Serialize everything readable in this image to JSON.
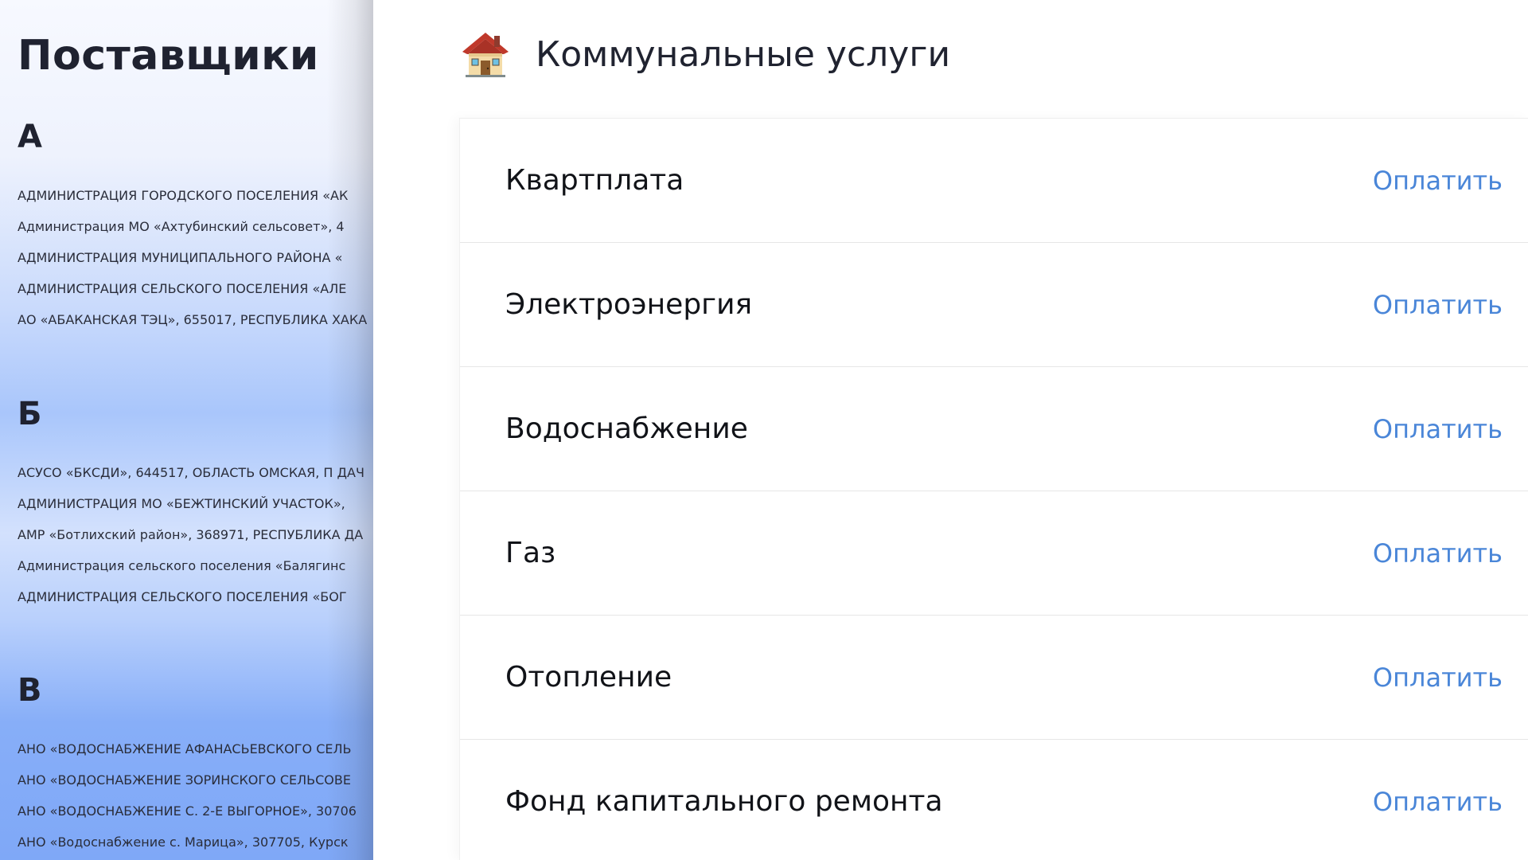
{
  "suppliers": {
    "title": "Поставщики",
    "groups": [
      {
        "letter": "А",
        "items": [
          "АДМИНИСТРАЦИЯ ГОРОДСКОГО ПОСЕЛЕНИЯ «АК",
          "Администрация МО «Ахтубинский сельсовет», 4",
          "АДМИНИСТРАЦИЯ МУНИЦИПАЛЬНОГО РАЙОНА «",
          "АДМИНИСТРАЦИЯ СЕЛЬСКОГО ПОСЕЛЕНИЯ «АЛЕ",
          "АО «АБАКАНСКАЯ ТЭЦ», 655017, РЕСПУБЛИКА ХАКА"
        ]
      },
      {
        "letter": "Б",
        "items": [
          "АСУСО «БКСДИ», 644517, ОБЛАСТЬ ОМСКАЯ, П ДАЧ",
          "АДМИНИСТРАЦИЯ МО «БЕЖТИНСКИЙ УЧАСТОК»,",
          "АМР «Ботлихский район», 368971, РЕСПУБЛИКА ДА",
          "Администрация сельского поселения «Балягинс",
          "АДМИНИСТРАЦИЯ СЕЛЬСКОГО ПОСЕЛЕНИЯ «БОГ"
        ]
      },
      {
        "letter": "В",
        "items": [
          "АНО «ВОДОСНАБЖЕНИЕ АФАНАСЬЕВСКОГО СЕЛЬ",
          "АНО «ВОДОСНАБЖЕНИЕ ЗОРИНСКОГО СЕЛЬСОВЕ",
          "АНО «ВОДОСНАБЖЕНИЕ С. 2-Е ВЫГОРНОЕ», 30706",
          "АНО «Водоснабжение с. Марица», 307705, Курск"
        ]
      }
    ]
  },
  "services": {
    "icon": "house-icon",
    "title": "Коммунальные услуги",
    "pay_label": "Оплатить",
    "items": [
      {
        "name": "Квартплата",
        "action": "Оплатить"
      },
      {
        "name": "Электроэнергия",
        "action": "Оплатить"
      },
      {
        "name": "Водоснабжение",
        "action": "Оплатить"
      },
      {
        "name": "Газ",
        "action": "Оплатить"
      },
      {
        "name": "Отопление",
        "action": "Оплатить"
      },
      {
        "name": "Фонд капитального ремонта",
        "action": "Оплатить"
      }
    ]
  },
  "colors": {
    "link": "#4a86d8",
    "text": "#111318",
    "heading": "#1f2230",
    "panel_gradient_top": "#f7f9ff",
    "panel_gradient_bottom": "#7fa8f7"
  }
}
